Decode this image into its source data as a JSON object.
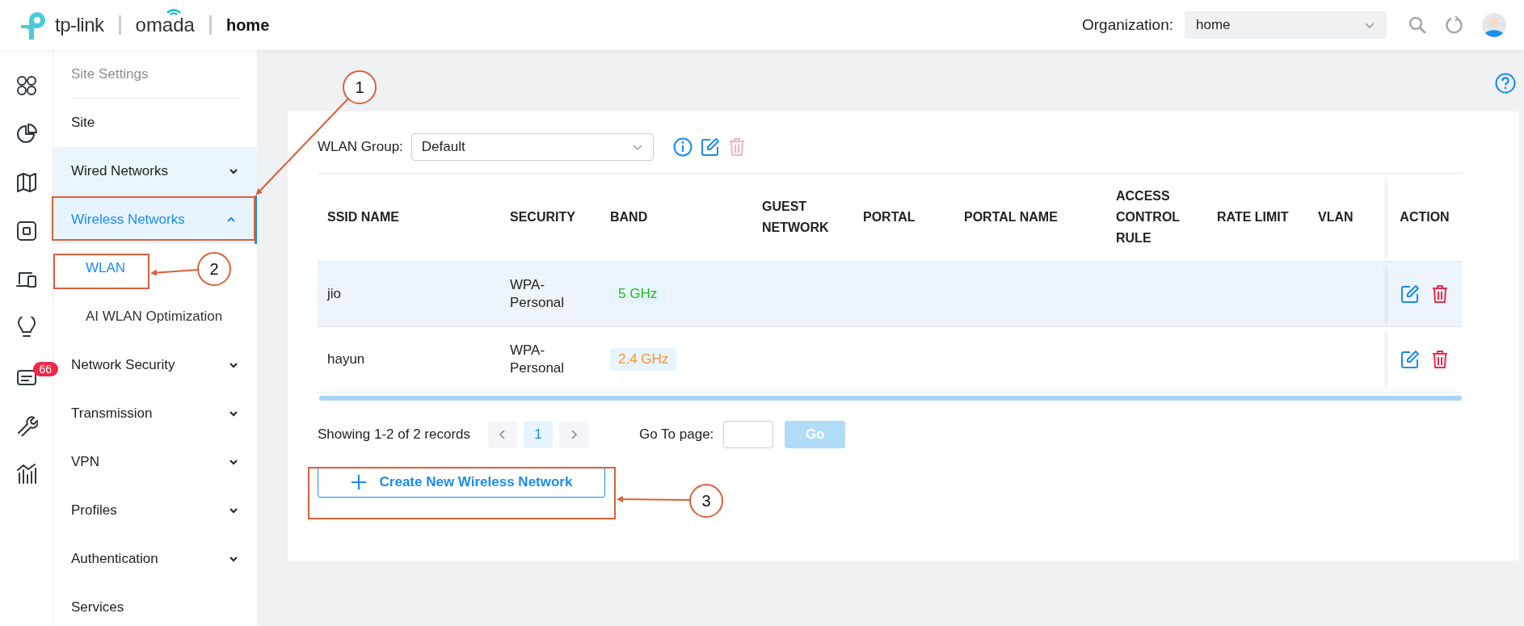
{
  "header": {
    "brand": "tp-link",
    "product": "omada",
    "site": "home",
    "organization_label": "Organization:",
    "organization": "home"
  },
  "nav_rail": [
    {
      "kind": "apps"
    },
    {
      "kind": "pie"
    },
    {
      "kind": "map"
    },
    {
      "kind": "device"
    },
    {
      "kind": "devices"
    },
    {
      "kind": "bulb"
    },
    {
      "kind": "logs",
      "badge": "66"
    },
    {
      "kind": "wrench"
    },
    {
      "kind": "chart"
    }
  ],
  "sidebar": {
    "title": "Site Settings",
    "items": [
      {
        "label": "Site",
        "kind": "link",
        "selected": false,
        "hovered": false
      },
      {
        "label": "Wired Networks",
        "kind": "group",
        "expanded": false,
        "selected": false,
        "hovered": true
      },
      {
        "label": "Wireless Networks",
        "kind": "group",
        "expanded": true,
        "selected": true,
        "hovered": false,
        "children": [
          {
            "label": "WLAN",
            "selected": true
          },
          {
            "label": "AI WLAN Optimization",
            "selected": false
          }
        ]
      },
      {
        "label": "Network Security",
        "kind": "group",
        "expanded": false,
        "selected": false,
        "hovered": false
      },
      {
        "label": "Transmission",
        "kind": "group",
        "expanded": false,
        "selected": false,
        "hovered": false
      },
      {
        "label": "VPN",
        "kind": "group",
        "expanded": false,
        "selected": false,
        "hovered": false
      },
      {
        "label": "Profiles",
        "kind": "group",
        "expanded": false,
        "selected": false,
        "hovered": false
      },
      {
        "label": "Authentication",
        "kind": "group",
        "expanded": false,
        "selected": false,
        "hovered": false
      },
      {
        "label": "Services",
        "kind": "link",
        "selected": false,
        "hovered": false
      }
    ]
  },
  "wlan_group": {
    "label": "WLAN Group:",
    "value": "Default",
    "delete_disabled": true
  },
  "table": {
    "columns": [
      "SSID NAME",
      "SECURITY",
      "BAND",
      "GUEST NETWORK",
      "PORTAL",
      "PORTAL NAME",
      "ACCESS CONTROL RULE",
      "RATE LIMIT",
      "VLAN",
      "ACTION"
    ],
    "rows": [
      {
        "ssid": "jio",
        "security": "WPA-Personal",
        "band": {
          "label": "5 GHz",
          "color": "#22b822"
        },
        "selected": true
      },
      {
        "ssid": "hayun",
        "security": "WPA-Personal",
        "band": {
          "label": "2.4 GHz",
          "color": "#f5922f"
        },
        "selected": false
      }
    ]
  },
  "pagination": {
    "summary": "Showing 1-2 of 2 records",
    "pages": [
      {
        "label": "1",
        "selected": true
      }
    ],
    "goto_label": "Go To page:",
    "go": {
      "label": "Go",
      "disabled": true
    }
  },
  "create_button": {
    "label": "Create New Wireless Network"
  },
  "annotations": [
    {
      "label": "1"
    },
    {
      "label": "2"
    },
    {
      "label": "3"
    }
  ]
}
